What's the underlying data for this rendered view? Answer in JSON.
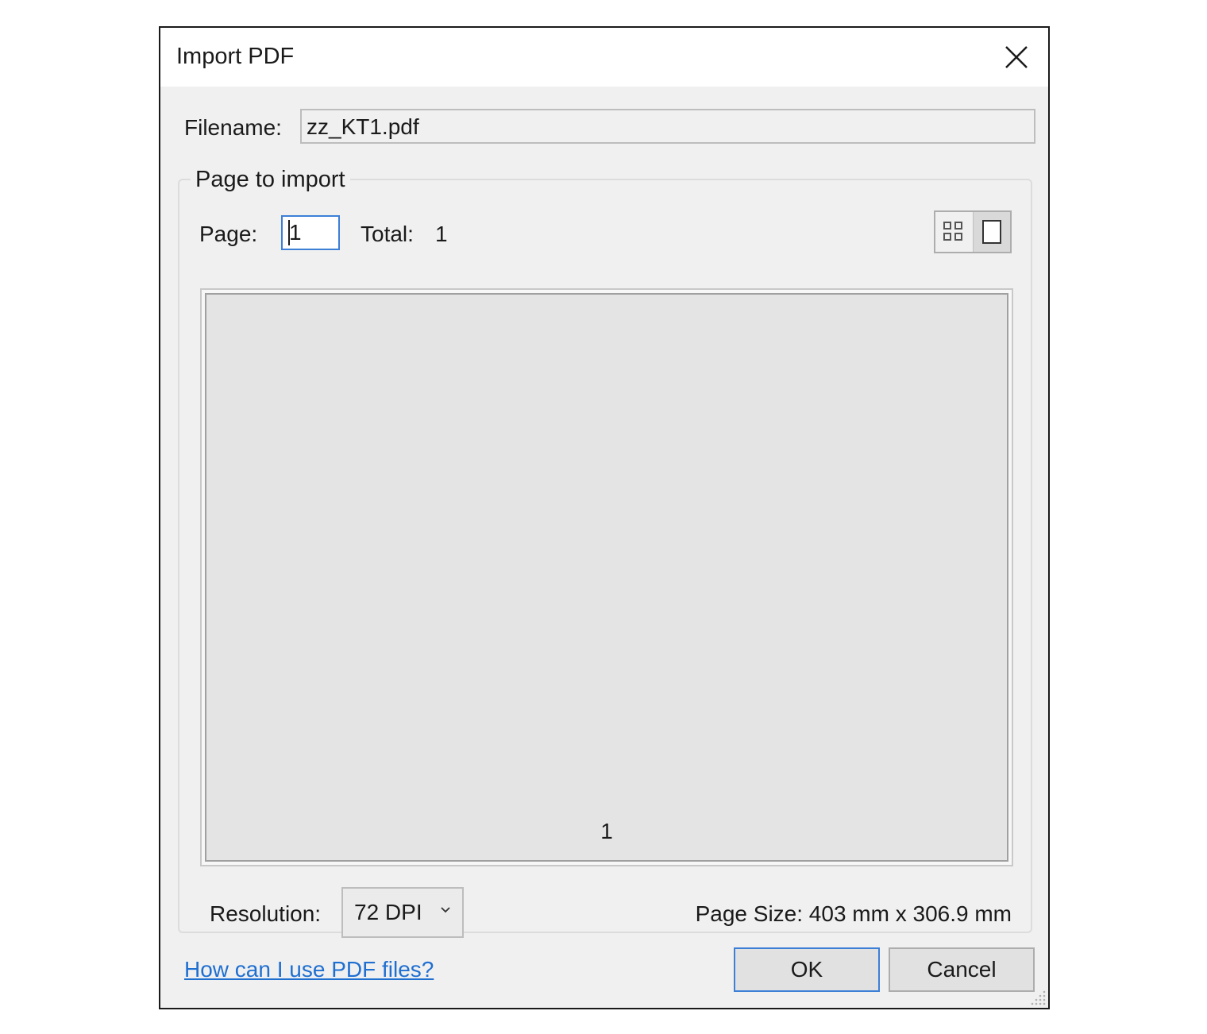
{
  "window": {
    "title": "Import PDF"
  },
  "filename": {
    "label": "Filename:",
    "value": "zz_KT1.pdf"
  },
  "group": {
    "title": "Page to import",
    "page_label": "Page:",
    "page_value": "1",
    "total_label": "Total:",
    "total_value": "1",
    "view_modes": [
      "grid-view-icon",
      "single-page-icon"
    ],
    "active_view": "single-page-icon"
  },
  "preview": {
    "page_number": "1"
  },
  "resolution": {
    "label": "Resolution:",
    "selected": "72 DPI"
  },
  "page_size": {
    "text": "Page Size:  403 mm x 306.9 mm"
  },
  "footer": {
    "help_link": "How can I use PDF files?",
    "ok_label": "OK",
    "cancel_label": "Cancel"
  },
  "colors": {
    "accent": "#3c7fd6",
    "link": "#1f6fd1",
    "dialog_bg": "#f0f0f0",
    "preview_bg": "#e4e4e4"
  }
}
